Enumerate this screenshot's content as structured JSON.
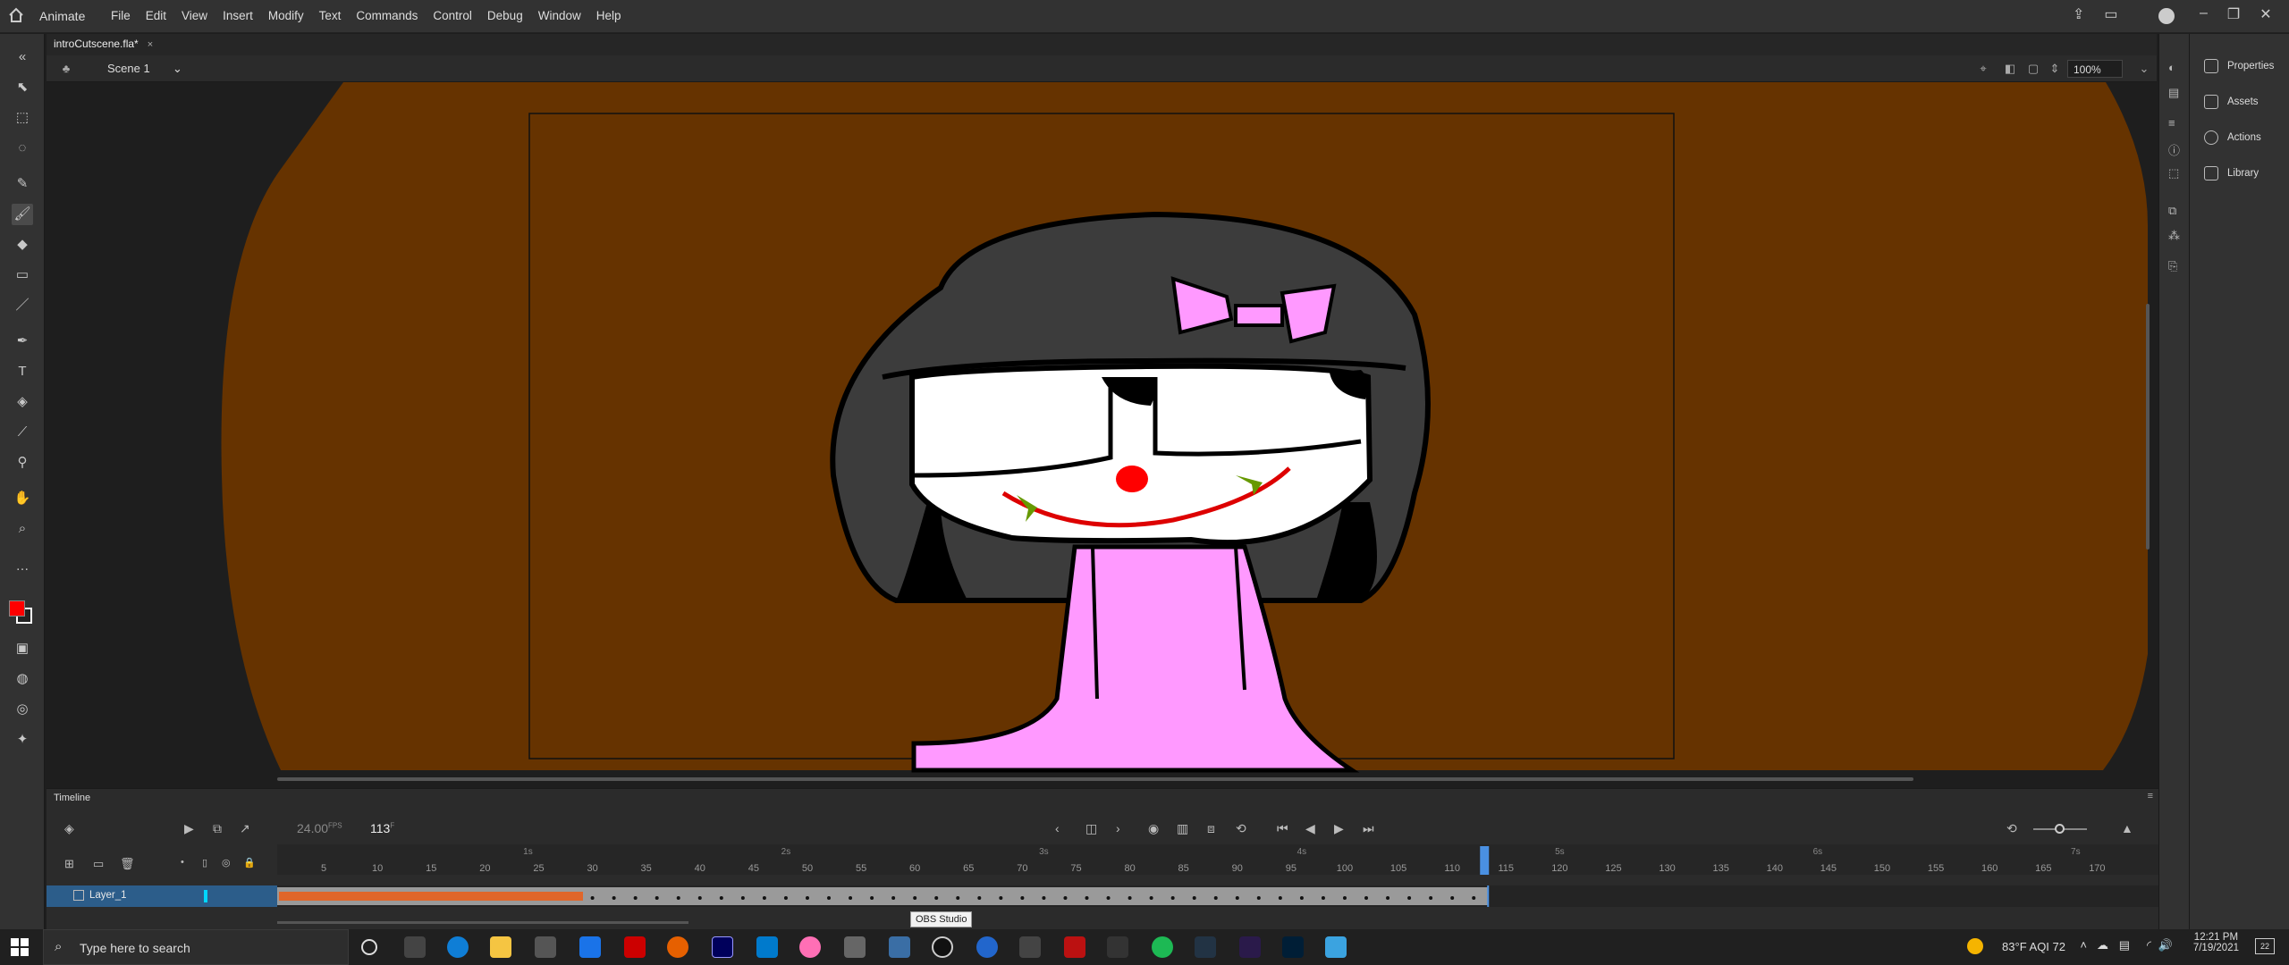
{
  "app": {
    "name": "Animate"
  },
  "menu": [
    "File",
    "Edit",
    "View",
    "Insert",
    "Modify",
    "Text",
    "Commands",
    "Control",
    "Debug",
    "Window",
    "Help"
  ],
  "document": {
    "tab_title": "introCutscene.fla*",
    "close": "×",
    "scene": "Scene 1",
    "zoom": "100%"
  },
  "right_panel": {
    "items": [
      "Properties",
      "Assets",
      "Actions",
      "Library"
    ]
  },
  "timeline": {
    "title": "Timeline",
    "fps": "24.00",
    "fps_unit": "FPS",
    "current_frame": "113",
    "frame_unit": "F",
    "layer_name": "Layer_1",
    "seconds_labels": [
      "1s",
      "2s",
      "3s",
      "4s",
      "5s",
      "6s",
      "7s"
    ],
    "frame_numbers": [
      "5",
      "10",
      "15",
      "20",
      "25",
      "30",
      "35",
      "40",
      "45",
      "50",
      "55",
      "60",
      "65",
      "70",
      "75",
      "80",
      "85",
      "90",
      "95",
      "100",
      "105",
      "110",
      "115",
      "120",
      "125",
      "130",
      "135",
      "140",
      "145",
      "150",
      "155",
      "160",
      "165",
      "170"
    ]
  },
  "tooltip": "OBS Studio",
  "taskbar": {
    "search_placeholder": "Type here to search",
    "weather": "83°F  AQI 72",
    "time": "12:21 PM",
    "date": "7/19/2021",
    "notifications": "22"
  },
  "colors": {
    "stage_bg": "#663300",
    "fill_color": "#ff0000",
    "skin_pink": "#ff99ff",
    "hair": "#3a3a3a",
    "playhead": "#4a90e2"
  }
}
